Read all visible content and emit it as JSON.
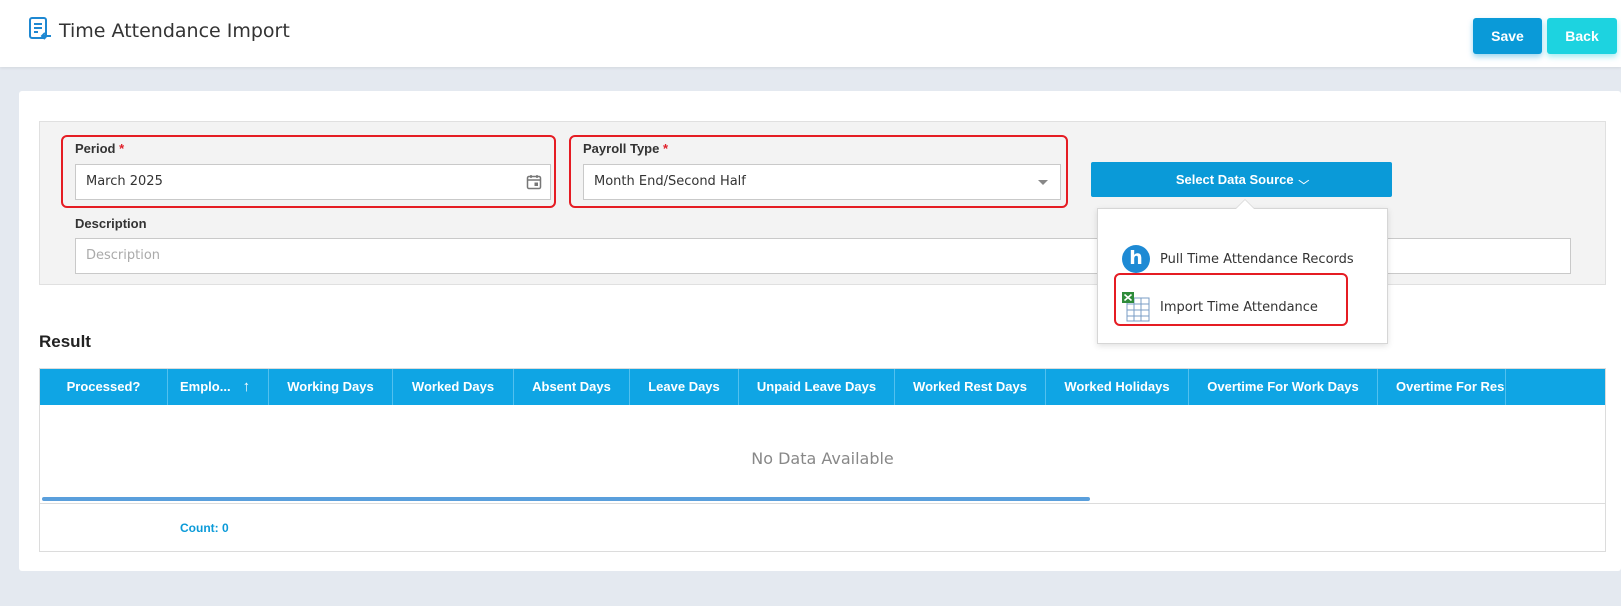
{
  "header": {
    "title": "Time Attendance Import",
    "save_label": "Save",
    "back_label": "Back"
  },
  "form": {
    "period": {
      "label": "Period",
      "required_mark": "*",
      "value": "March 2025"
    },
    "payroll_type": {
      "label": "Payroll Type",
      "required_mark": "*",
      "value": "Month End/Second Half"
    },
    "description": {
      "label": "Description",
      "placeholder": "Description",
      "value": ""
    },
    "data_source_button": "Select Data Source"
  },
  "data_source_menu": {
    "items": [
      {
        "label": "Pull Time Attendance Records",
        "icon": "h-logo-icon",
        "icon_text": "h"
      },
      {
        "label": "Import Time Attendance",
        "icon": "excel-icon"
      }
    ]
  },
  "result": {
    "title": "Result",
    "columns": [
      "Processed?",
      "Emplo...",
      "Working Days",
      "Worked Days",
      "Absent Days",
      "Leave Days",
      "Unpaid Leave Days",
      "Worked Rest Days",
      "Worked Holidays",
      "Overtime For Work Days",
      "Overtime For Res"
    ],
    "sort_indicator": "↑",
    "empty_text": "No Data Available",
    "count_label": "Count: 0"
  },
  "colors": {
    "primary": "#0a9ad8",
    "secondary": "#1dd3e0",
    "grid_header": "#0fa5e4",
    "highlight": "#e51c23"
  }
}
